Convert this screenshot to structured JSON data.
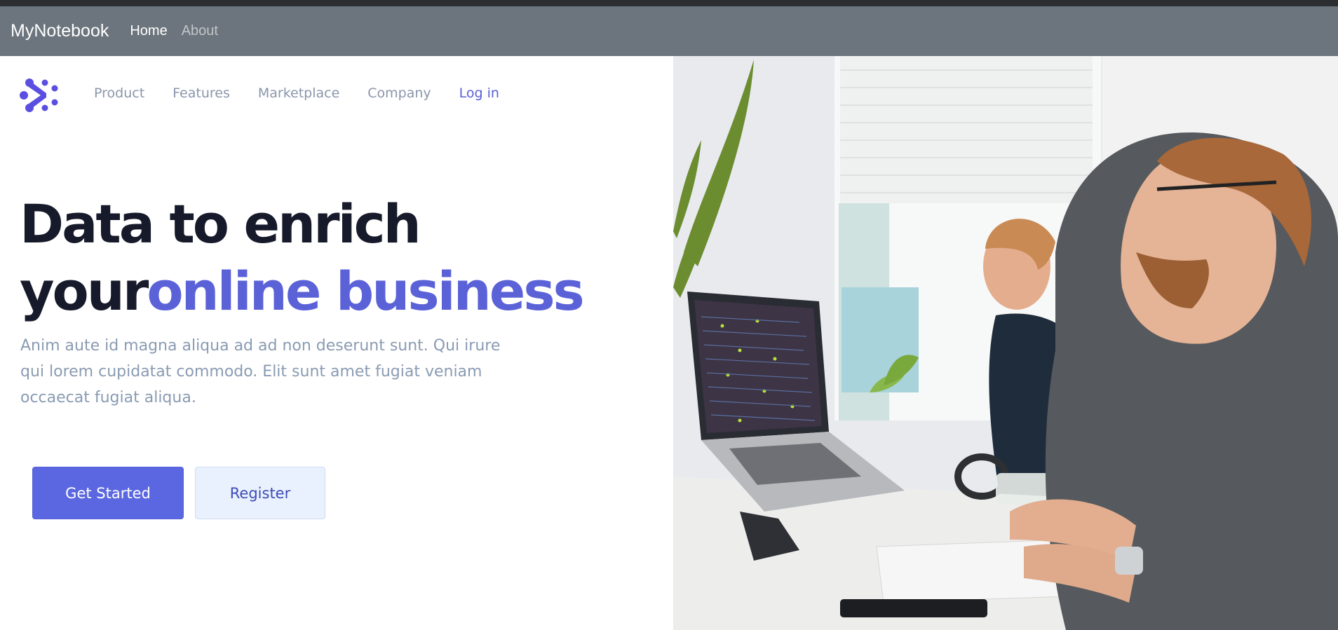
{
  "app": {
    "title": "MyNotebook",
    "nav": [
      {
        "label": "Home",
        "active": true
      },
      {
        "label": "About",
        "active": false
      }
    ]
  },
  "site": {
    "nav": [
      "Product",
      "Features",
      "Marketplace",
      "Company"
    ],
    "login": "Log in"
  },
  "hero": {
    "line1": "Data to enrich",
    "line2_dark": "your",
    "line2_accent": "online business",
    "body": "Anim aute id magna aliqua ad ad non deserunt sunt. Qui irure qui lorem cupidatat commodo. Elit sunt amet fugiat veniam occaecat fugiat aliqua.",
    "primary_button": "Get Started",
    "secondary_button": "Register"
  },
  "colors": {
    "app_bar": "#6c757d",
    "accent": "#5b62d8",
    "primary_button": "#5b67e0",
    "secondary_button": "#e9f1fe"
  }
}
